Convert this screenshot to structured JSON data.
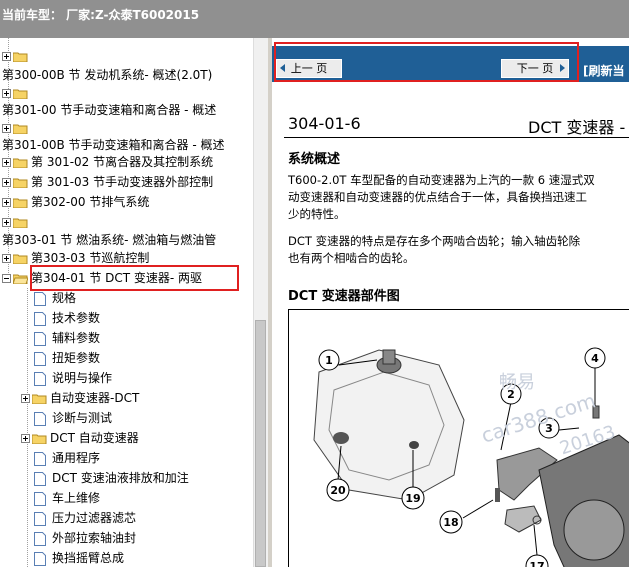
{
  "header": {
    "car_model_label": "当前车型：  厂家:Z-众泰T6002015"
  },
  "tree": {
    "items": [
      {
        "label": "第300-00B 节 发动机系统- 概述(2.0T)"
      },
      {
        "label": "第301-00 节手动变速箱和离合器 - 概述"
      },
      {
        "label": "第301-00B 节手动变速箱和离合器 - 概述"
      },
      {
        "label": "第 301-02 节离合器及其控制系统"
      },
      {
        "label": "第 301-03 节手动变速器外部控制"
      },
      {
        "label": "第302-00 节排气系统"
      },
      {
        "label": "第303-01 节 燃油系统- 燃油箱与燃油管"
      },
      {
        "label": "第303-03 节巡航控制"
      },
      {
        "label": "第304-01 节 DCT 变速器- 两驱"
      }
    ],
    "children": [
      {
        "label": "规格"
      },
      {
        "label": "技术参数"
      },
      {
        "label": "辅料参数"
      },
      {
        "label": "扭矩参数"
      },
      {
        "label": "说明与操作"
      },
      {
        "label": "自动变速器-DCT"
      },
      {
        "label": "诊断与测试"
      },
      {
        "label": "DCT 自动变速器"
      },
      {
        "label": "通用程序"
      },
      {
        "label": "DCT 变速油液排放和加注"
      },
      {
        "label": "车上维修"
      },
      {
        "label": "压力过滤器滤芯"
      },
      {
        "label": "外部拉索轴油封"
      },
      {
        "label": "换挡摇臂总成"
      }
    ]
  },
  "nav": {
    "prev_label": "上一 页",
    "next_label": "下一 页",
    "refresh_label": "[刷新当"
  },
  "document": {
    "page_number": "304-01-6",
    "title": "DCT 变速器 -",
    "section_title": "系统概述",
    "paragraph1_line1": "T600-2.0T 车型配备的自动变速器为上汽的一款 6 速湿式双",
    "paragraph1_line2": "动变速器和自动变速器的优点结合于一体，具备换挡迅速工",
    "paragraph1_line3": "少的特性。",
    "paragraph2_line1": "DCT 变速器的特点是存在多个两啮合齿轮；输入轴齿轮除",
    "paragraph2_line2": "也有两个相啮合的齿轮。",
    "figure_title": "DCT 变速器部件图",
    "callouts": [
      "1",
      "2",
      "3",
      "4",
      "20",
      "19",
      "18",
      "17"
    ],
    "watermark_line1": "畅易",
    "watermark_line2": "car388.com",
    "watermark_line3": "20163"
  },
  "colors": {
    "navbar": "#1f5f96",
    "topbar": "#909090",
    "highlight_box": "#e02020"
  }
}
